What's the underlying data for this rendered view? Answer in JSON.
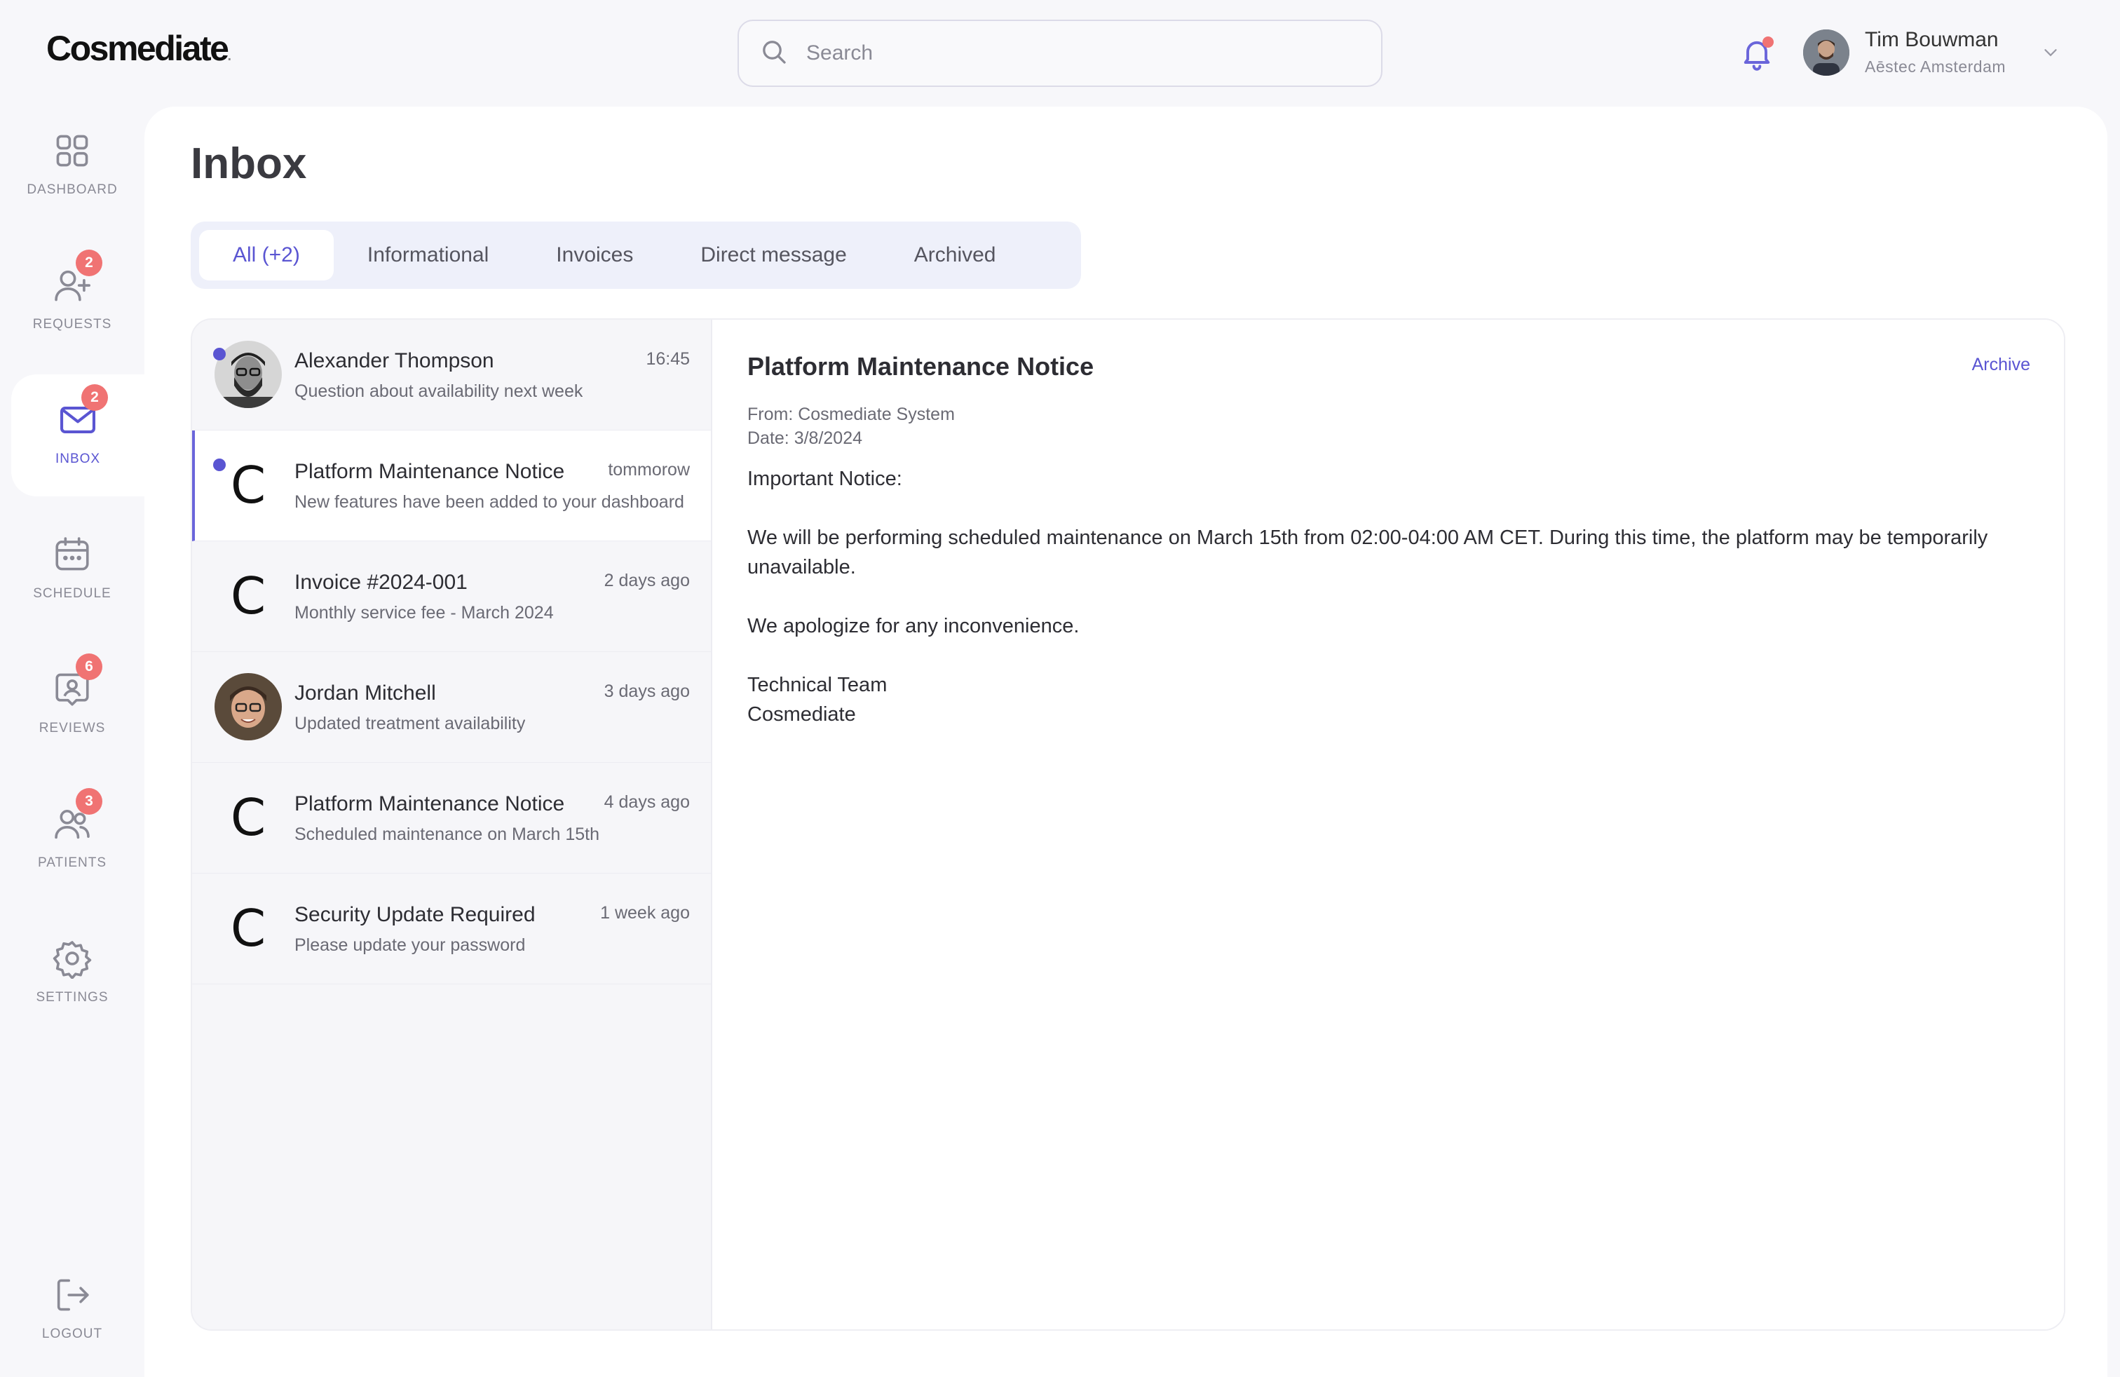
{
  "brand": {
    "name": "Cosmediate",
    "mark": "."
  },
  "search": {
    "placeholder": "Search"
  },
  "user": {
    "name": "Tim Bouwman",
    "org": "Aēstec Amsterdam"
  },
  "sidebar": {
    "items": [
      {
        "label": "DASHBOARD",
        "icon": "grid-icon",
        "badge": ""
      },
      {
        "label": "REQUESTS",
        "icon": "user-plus-icon",
        "badge": "2"
      },
      {
        "label": "INBOX",
        "icon": "mail-icon",
        "badge": "2"
      },
      {
        "label": "SCHEDULE",
        "icon": "calendar-icon",
        "badge": ""
      },
      {
        "label": "REVIEWS",
        "icon": "review-icon",
        "badge": "6"
      },
      {
        "label": "PATIENTS",
        "icon": "users-icon",
        "badge": "3"
      },
      {
        "label": "SETTINGS",
        "icon": "gear-icon",
        "badge": ""
      }
    ],
    "logout": "LOGOUT"
  },
  "page": {
    "title": "Inbox"
  },
  "tabs": [
    "All (+2)",
    "Informational",
    "Invoices",
    "Direct message",
    "Archived"
  ],
  "messages": [
    {
      "name": "Alexander Thompson",
      "subject": "Question about availability next week",
      "time": "16:45",
      "avatar": "photo",
      "letter": "",
      "unread": true
    },
    {
      "name": "Platform Maintenance Notice",
      "subject": "New features have been added to your dashboard",
      "time": "tommorow",
      "avatar": "letter",
      "letter": "C",
      "unread": true
    },
    {
      "name": "Invoice #2024-001",
      "subject": "Monthly service fee - March 2024",
      "time": "2 days ago",
      "avatar": "letter",
      "letter": "C",
      "unread": false
    },
    {
      "name": "Jordan Mitchell",
      "subject": "Updated treatment availability",
      "time": "3 days ago",
      "avatar": "photo",
      "letter": "",
      "unread": false
    },
    {
      "name": "Platform Maintenance Notice",
      "subject": "Scheduled maintenance on March 15th",
      "time": "4 days ago",
      "avatar": "letter",
      "letter": "C",
      "unread": false
    },
    {
      "name": "Security Update Required",
      "subject": "Please update your password",
      "time": "1 week ago",
      "avatar": "letter",
      "letter": "C",
      "unread": false
    }
  ],
  "detail": {
    "title": "Platform Maintenance Notice",
    "archive": "Archive",
    "from": "From: Cosmediate System",
    "date": "Date: 3/8/2024",
    "heading": "Important Notice:",
    "paragraph1": "We will be performing scheduled maintenance on March 15th from 02:00-04:00 AM CET. During this time, the platform may be temporarily unavailable.",
    "paragraph2": "We apologize for any inconvenience.",
    "sign1": "Technical Team",
    "sign2": "Cosmediate"
  }
}
